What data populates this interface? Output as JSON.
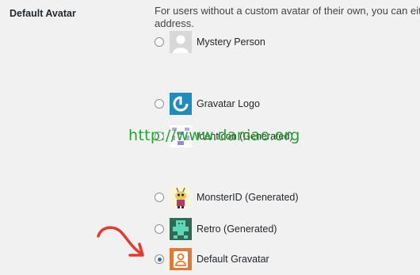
{
  "section_label": "Default Avatar",
  "description": {
    "line1": "For users without a custom avatar of their own, you can eith",
    "line2": "address."
  },
  "options": [
    {
      "label": "Mystery Person",
      "icon": "mystery-person-icon",
      "checked": false
    },
    {
      "label": "Gravatar Logo",
      "icon": "gravatar-logo-icon",
      "checked": false
    },
    {
      "label": "Identicon (Generated)",
      "icon": "identicon-icon",
      "checked": false
    },
    {
      "label": "MonsterID (Generated)",
      "icon": "monsterid-icon",
      "checked": false
    },
    {
      "label": "Retro (Generated)",
      "icon": "retro-icon",
      "checked": false
    },
    {
      "label": "Default Gravatar",
      "icon": "default-gravatar-icon",
      "checked": true
    }
  ],
  "watermark": "http://www.daniao.org",
  "colors": {
    "accent": "#2271b1",
    "arrow": "#e23b2e",
    "watermark": "#1fa82a",
    "gravatar_blue": "#1e8cbe",
    "default_gravatar_orange": "#e07a2e"
  }
}
